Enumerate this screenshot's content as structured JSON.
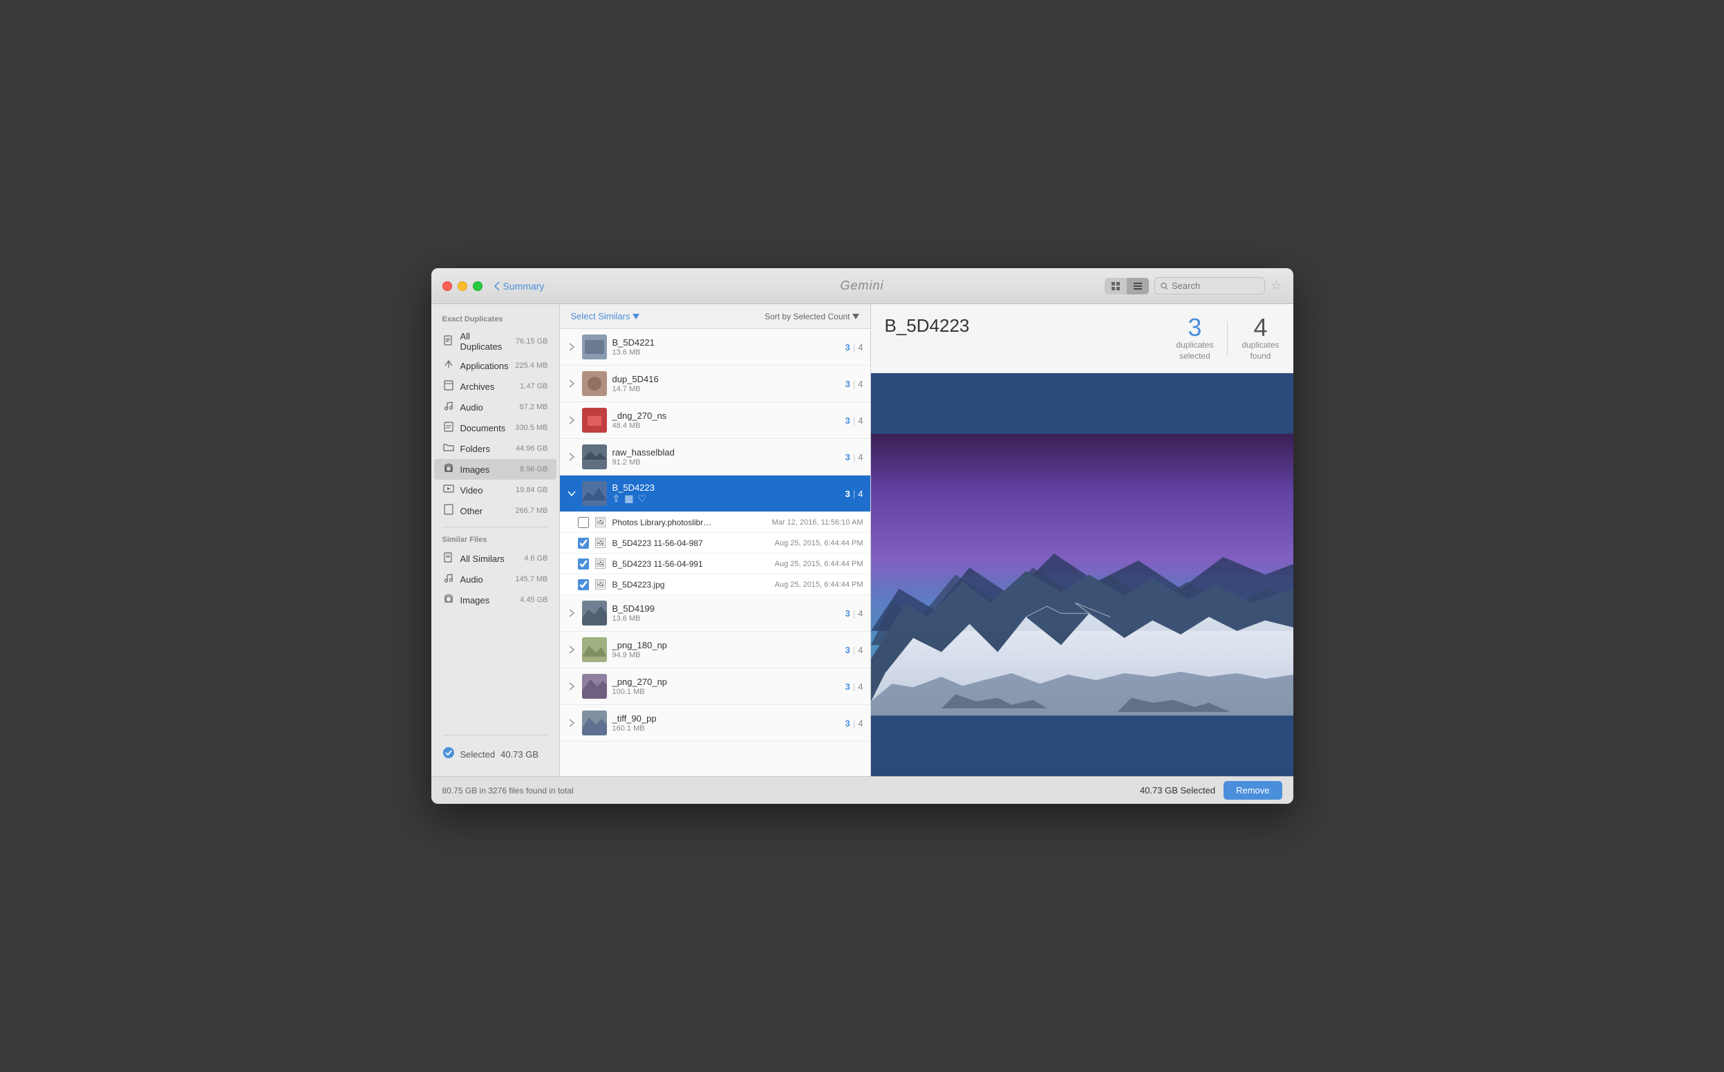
{
  "titlebar": {
    "title": "Gemini",
    "back_label": "Summary",
    "search_placeholder": "Search",
    "view_grid_label": "Grid View",
    "view_list_label": "List View"
  },
  "sidebar": {
    "exact_duplicates_label": "Exact Duplicates",
    "similar_files_label": "Similar Files",
    "exact_items": [
      {
        "id": "all-duplicates",
        "name": "All Duplicates",
        "size": "76.15 GB",
        "icon": "📋"
      },
      {
        "id": "applications",
        "name": "Applications",
        "size": "225.4 MB",
        "icon": "🔧"
      },
      {
        "id": "archives",
        "name": "Archives",
        "size": "1.47 GB",
        "icon": "📄"
      },
      {
        "id": "audio",
        "name": "Audio",
        "size": "87.2 MB",
        "icon": "🎵"
      },
      {
        "id": "documents",
        "name": "Documents",
        "size": "330.5 MB",
        "icon": "📄"
      },
      {
        "id": "folders",
        "name": "Folders",
        "size": "44.96 GB",
        "icon": "📁"
      },
      {
        "id": "images",
        "name": "Images",
        "size": "8.96 GB",
        "icon": "📷",
        "active": true
      },
      {
        "id": "video",
        "name": "Video",
        "size": "19.84 GB",
        "icon": "🎬"
      },
      {
        "id": "other",
        "name": "Other",
        "size": "266.7 MB",
        "icon": "📄"
      }
    ],
    "similar_items": [
      {
        "id": "all-similars",
        "name": "All Similars",
        "size": "4.6 GB",
        "icon": "📋"
      },
      {
        "id": "audio-sim",
        "name": "Audio",
        "size": "145.7 MB",
        "icon": "🎵"
      },
      {
        "id": "images-sim",
        "name": "Images",
        "size": "4.45 GB",
        "icon": "📷"
      }
    ],
    "selected_label": "Selected",
    "selected_size": "40.73 GB"
  },
  "file_list": {
    "select_similars_label": "Select Similars",
    "sort_label": "Sort by Selected Count",
    "groups": [
      {
        "id": "B_5D4221",
        "name": "B_5D4221",
        "size": "13.6 MB",
        "selected": 3,
        "total": 4,
        "expanded": false,
        "thumb_color": "#8a9ab0"
      },
      {
        "id": "dup_5D416",
        "name": "dup_5D416",
        "size": "14.7 MB",
        "selected": 3,
        "total": 4,
        "expanded": false,
        "thumb_color": "#b09080"
      },
      {
        "id": "_dng_270_ns",
        "name": "_dng_270_ns",
        "size": "48.4 MB",
        "selected": 3,
        "total": 4,
        "expanded": false,
        "thumb_color": "#c04040"
      },
      {
        "id": "raw_hasselblad",
        "name": "raw_hasselblad",
        "size": "91.2 MB",
        "selected": 3,
        "total": 4,
        "expanded": false,
        "thumb_color": "#607080"
      },
      {
        "id": "B_5D4223",
        "name": "B_5D4223",
        "size": "",
        "selected": 3,
        "total": 4,
        "expanded": true,
        "thumb_color": "#5070a0",
        "files": [
          {
            "id": "photos-lib",
            "name": "Photos Library.photoslibr…",
            "date": "Mar 12, 2016, 11:56:10 AM",
            "checked": false,
            "type": "🖼"
          },
          {
            "id": "b5d4223-987",
            "name": "B_5D4223 11-56-04-987",
            "date": "Aug 25, 2015, 6:44:44 PM",
            "checked": true,
            "type": "🖼"
          },
          {
            "id": "b5d4223-991",
            "name": "B_5D4223 11-56-04-991",
            "date": "Aug 25, 2015, 6:44:44 PM",
            "checked": true,
            "type": "🖼"
          },
          {
            "id": "b5d4223-jpg",
            "name": "B_5D4223.jpg",
            "date": "Aug 25, 2015, 6:44:44 PM",
            "checked": true,
            "type": "🖼"
          }
        ]
      },
      {
        "id": "B_5D4199",
        "name": "B_5D4199",
        "size": "13.6 MB",
        "selected": 3,
        "total": 4,
        "expanded": false,
        "thumb_color": "#708090"
      },
      {
        "id": "_png_180_np",
        "name": "_png_180_np",
        "size": "94.9 MB",
        "selected": 3,
        "total": 4,
        "expanded": false,
        "thumb_color": "#a0b080"
      },
      {
        "id": "_png_270_np",
        "name": "_png_270_np",
        "size": "100.1 MB",
        "selected": 3,
        "total": 4,
        "expanded": false,
        "thumb_color": "#9080a0"
      },
      {
        "id": "_tiff_90_pp",
        "name": "_tiff_90_pp",
        "size": "160.1 MB",
        "selected": 3,
        "total": 4,
        "expanded": false,
        "thumb_color": "#8090a0"
      }
    ]
  },
  "preview": {
    "title": "B_5D4223",
    "duplicates_selected": 3,
    "duplicates_selected_label": "duplicates\nselected",
    "duplicates_found": 4,
    "duplicates_found_label": "duplicates\nfound"
  },
  "bottom_bar": {
    "status_text": "80.75 GB in 3276 files found in total",
    "selected_text": "40.73 GB Selected",
    "remove_label": "Remove"
  }
}
